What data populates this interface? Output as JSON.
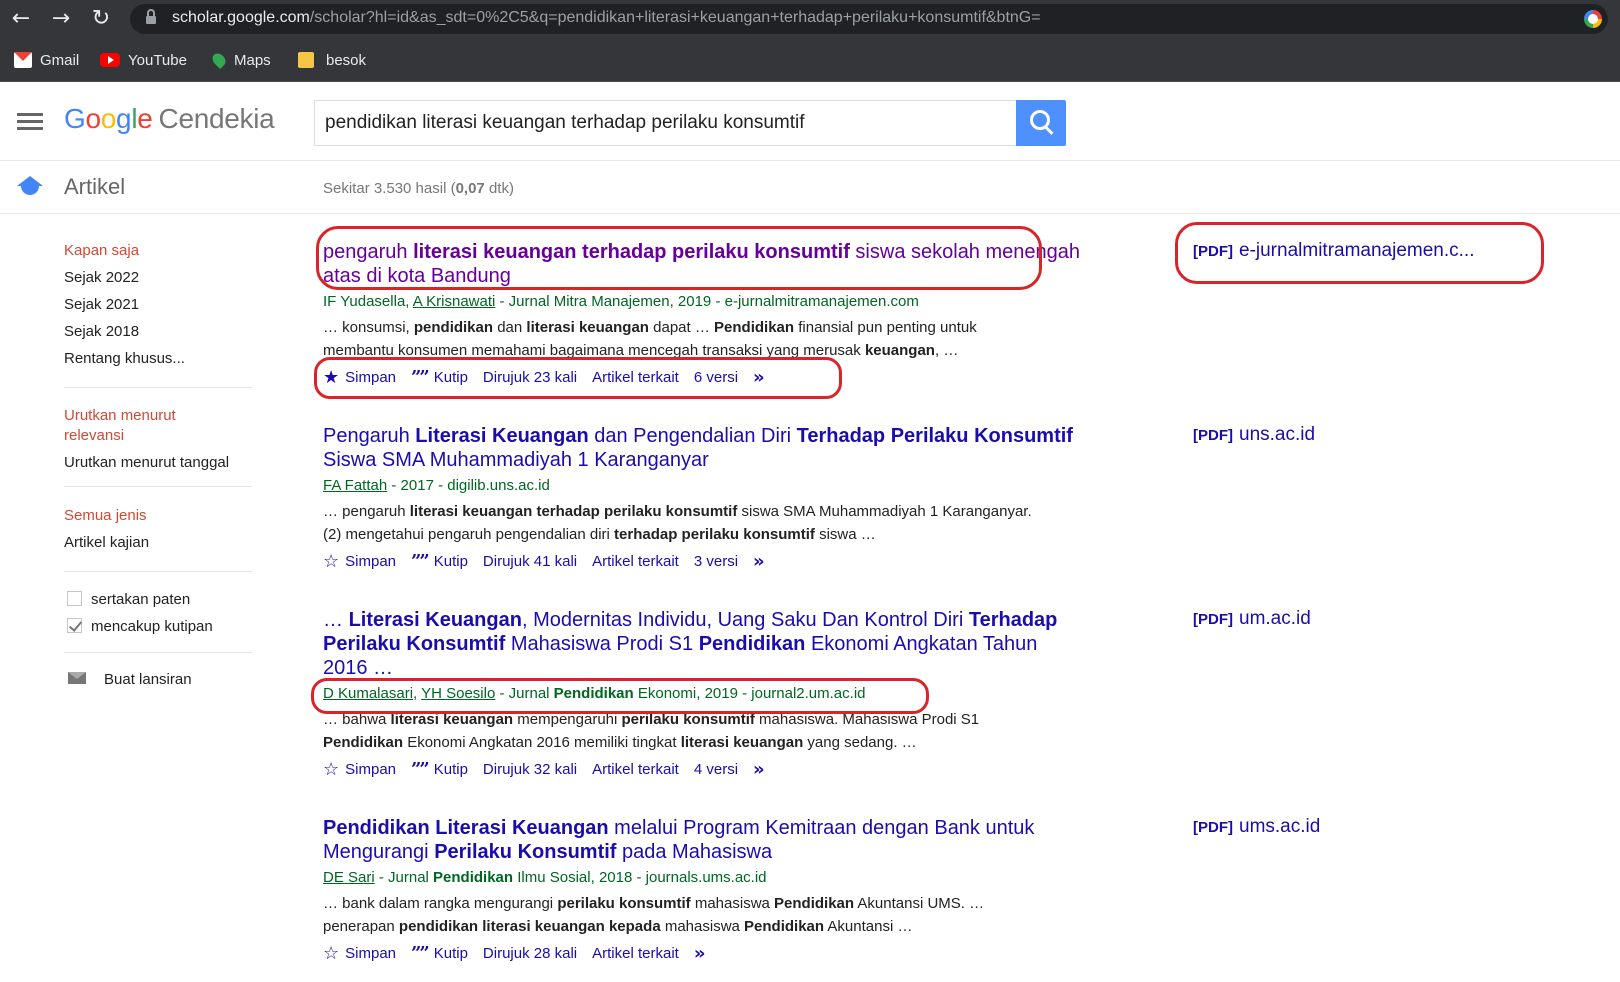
{
  "browser": {
    "url_host": "scholar.google.com",
    "url_path": "/scholar?hl=id&as_sdt=0%2C5&q=pendidikan+literasi+keuangan+terhadap+perilaku+konsumtif&btnG=",
    "bookmarks": [
      "Gmail",
      "YouTube",
      "Maps",
      "besok"
    ]
  },
  "header": {
    "logo_letters": [
      "G",
      "o",
      "o",
      "g",
      "l",
      "e"
    ],
    "logo_suffix": "Cendekia",
    "search_value": "pendidikan literasi keuangan terhadap perilaku konsumtif"
  },
  "subheader": {
    "section": "Artikel",
    "count_prefix": "Sekitar 3.530 hasil (",
    "count_time": "0,07",
    "count_suffix": " dtk)"
  },
  "sidebar": {
    "time_filters": [
      "Kapan saja",
      "Sejak 2022",
      "Sejak 2021",
      "Sejak 2018",
      "Rentang khusus..."
    ],
    "sort_options": [
      "Urutkan menurut relevansi",
      "Urutkan menurut tanggal"
    ],
    "type_filters": [
      "Semua jenis",
      "Artikel kajian"
    ],
    "checkboxes": [
      {
        "label": "sertakan paten",
        "checked": false
      },
      {
        "label": "mencakup kutipan",
        "checked": true
      }
    ],
    "alert": "Buat lansiran"
  },
  "results": [
    {
      "pdf_tag": "[PDF]",
      "pdf_domain": "e-jurnalmitramanajemen.c...",
      "meta_tail": " - Jurnal Mitra Manajemen, 2019 - e-jurnalmitramanajemen.com",
      "authors": [
        "IF Yudasella",
        "A Krisnawati"
      ],
      "actions": [
        "Simpan",
        "Kutip",
        "Dirujuk 23 kali",
        "Artikel terkait",
        "6 versi"
      ]
    },
    {
      "pdf_tag": "[PDF]",
      "pdf_domain": "uns.ac.id",
      "authors": [
        "FA Fattah"
      ],
      "meta_tail": " - 2017 - digilib.uns.ac.id",
      "actions": [
        "Simpan",
        "Kutip",
        "Dirujuk 41 kali",
        "Artikel terkait",
        "3 versi"
      ]
    },
    {
      "pdf_tag": "[PDF]",
      "pdf_domain": "um.ac.id",
      "authors": [
        "D Kumalasari",
        "YH Soesilo"
      ],
      "actions": [
        "Simpan",
        "Kutip",
        "Dirujuk 32 kali",
        "Artikel terkait",
        "4 versi"
      ]
    },
    {
      "pdf_tag": "[PDF]",
      "pdf_domain": "ums.ac.id",
      "authors": [
        "DE Sari"
      ],
      "actions": [
        "Simpan",
        "Kutip",
        "Dirujuk 28 kali",
        "Artikel terkait"
      ]
    }
  ],
  "rich": {
    "r0_title": [
      "pengaruh ",
      "literasi keuangan terhadap perilaku konsumtif",
      " siswa sekolah menengah atas di kota Bandung"
    ],
    "r0_snippet": [
      "… konsumsi, ",
      "pendidikan",
      " dan ",
      "literasi keuangan",
      " dapat … ",
      "Pendidikan",
      " finansial pun penting untuk membantu konsumen memahami bagaimana mencegah transaksi yang merusak ",
      "keuangan",
      ", …"
    ],
    "r1_title": [
      "Pengaruh ",
      "Literasi Keuangan",
      " dan Pengendalian Diri ",
      "Terhadap Perilaku Konsumtif",
      " Siswa SMA Muhammadiyah 1 Karanganyar"
    ],
    "r1_snippet": [
      "… pengaruh ",
      "literasi keuangan terhadap perilaku konsumtif",
      " siswa SMA Muhammadiyah 1 Karanganyar.(2) mengetahui pengaruh pengendalian diri ",
      "terhadap perilaku konsumtif",
      " siswa …"
    ],
    "r2_title": [
      "… ",
      "Literasi Keuangan",
      ", Modernitas Individu, Uang Saku Dan Kontrol Diri ",
      "Terhadap Perilaku Konsumtif",
      " Mahasiswa Prodi S1 ",
      "Pendidikan",
      " Ekonomi Angkatan Tahun 2016 …"
    ],
    "r2_meta": [
      " - Jurnal ",
      "Pendidikan",
      " Ekonomi, 2019 - journal2.um.ac.id"
    ],
    "r2_snippet": [
      "… bahwa ",
      "literasi keuangan",
      " mempengaruhi ",
      "perilaku konsumtif",
      " mahasiswa. Mahasiswa Prodi S1 ",
      "Pendidikan",
      " Ekonomi Angkatan 2016 memiliki tingkat ",
      "literasi keuangan",
      " yang sedang. …"
    ],
    "r3_title": [
      "Pendidikan Literasi Keuangan",
      " melalui Program Kemitraan dengan Bank untuk Mengurangi ",
      "Perilaku Konsumtif",
      " pada Mahasiswa"
    ],
    "r3_meta": [
      " - Jurnal ",
      "Pendidikan",
      " Ilmu Sosial, 2018 - journals.ums.ac.id"
    ],
    "r3_snippet": [
      "… bank dalam rangka mengurangi ",
      "perilaku konsumtif",
      " mahasiswa ",
      "Pendidikan",
      " Akuntansi UMS. … penerapan ",
      "pendidikan literasi keuangan kepada",
      " mahasiswa ",
      "Pendidikan",
      " Akuntansi …"
    ]
  },
  "colors": {
    "link": "#1a0dab",
    "visited": "#660099",
    "meta_green": "#006621",
    "annotation_red": "#d9252a",
    "scholar_red": "#d14836"
  }
}
